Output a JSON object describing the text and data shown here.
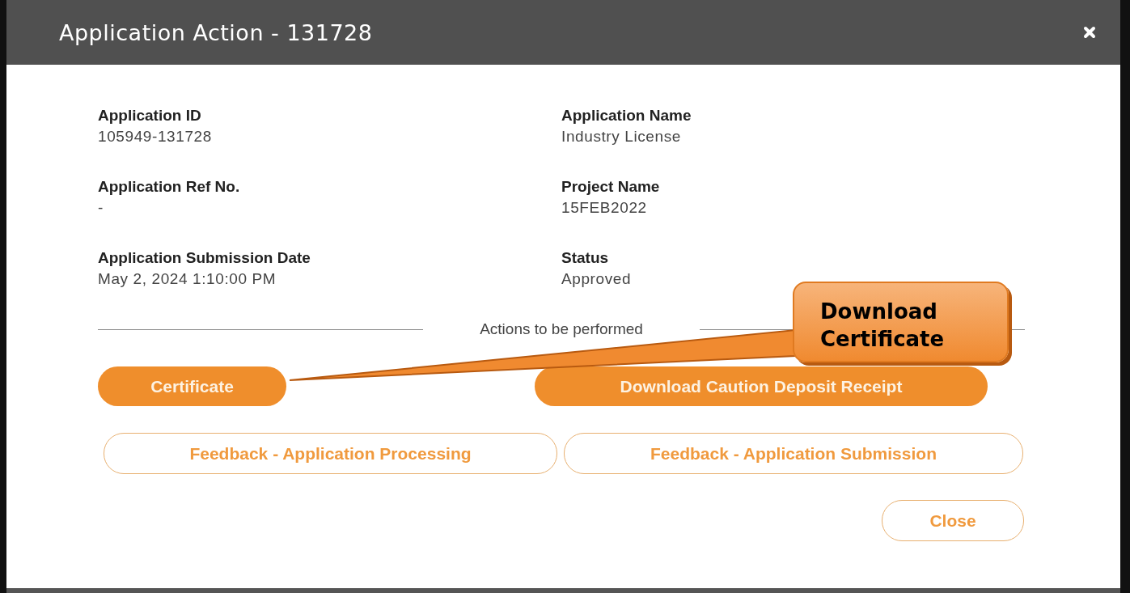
{
  "dialog": {
    "title": "Application Action - 131728"
  },
  "fields": [
    {
      "label": "Application ID",
      "value": "105949-131728"
    },
    {
      "label": "Application Name",
      "value": "Industry License"
    },
    {
      "label": "Application Ref No.",
      "value": "-"
    },
    {
      "label": "Project Name",
      "value": "15FEB2022"
    },
    {
      "label": "Application Submission Date",
      "value": "May 2, 2024 1:10:00 PM"
    },
    {
      "label": "Status",
      "value": "Approved"
    }
  ],
  "actions_heading": "Actions to be performed",
  "actions": [
    {
      "label": "Certificate",
      "kind": "filled"
    },
    {
      "label": "Download Caution Deposit Receipt",
      "kind": "filled"
    },
    {
      "label": "Feedback - Application Processing",
      "kind": "outline"
    },
    {
      "label": "Feedback - Application Submission",
      "kind": "outline"
    }
  ],
  "close_button": "Close",
  "callout": {
    "text": "Download Certificate"
  }
}
